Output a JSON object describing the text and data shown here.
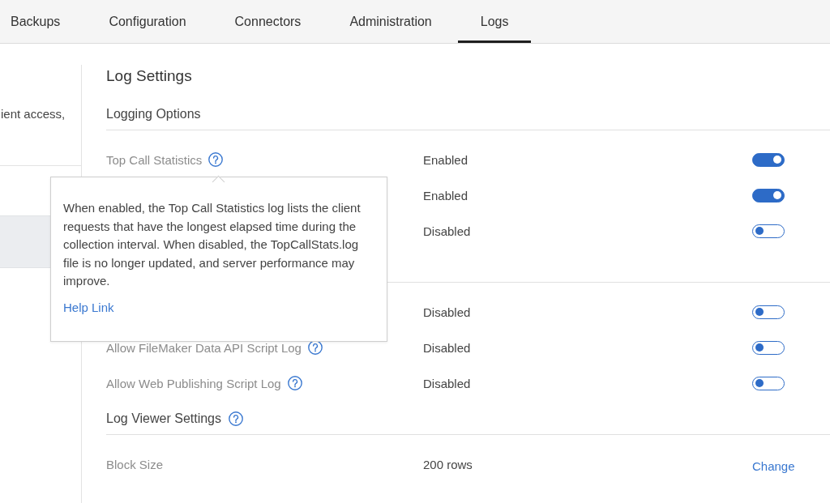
{
  "tabs": [
    {
      "label": "Backups",
      "selected": false
    },
    {
      "label": "Configuration",
      "selected": false
    },
    {
      "label": "Connectors",
      "selected": false
    },
    {
      "label": "Administration",
      "selected": false
    },
    {
      "label": "Logs",
      "selected": true
    }
  ],
  "sidebar": {
    "description": "ient access,",
    "items": [
      {
        "selected": true
      }
    ]
  },
  "title": "Log Settings",
  "sections": [
    {
      "title": "Logging Options",
      "rows": [
        {
          "kind": "toggle",
          "label": "Top Call Statistics",
          "help": true,
          "value": "Enabled",
          "on": true
        },
        {
          "kind": "toggle",
          "value": "Enabled",
          "on": true
        },
        {
          "kind": "toggle",
          "value": "Disabled",
          "on": false
        }
      ]
    },
    {
      "rows": [
        {
          "kind": "toggle",
          "value": "Disabled",
          "on": false
        },
        {
          "kind": "toggle",
          "label": "Allow FileMaker Data API Script Log",
          "help": true,
          "value": "Disabled",
          "on": false
        },
        {
          "kind": "toggle",
          "label": "Allow Web Publishing Script Log",
          "help": true,
          "value": "Disabled",
          "on": false
        }
      ]
    },
    {
      "title": "Log Viewer Settings",
      "help": true,
      "rows": [
        {
          "kind": "link",
          "label": "Block Size",
          "value": "200 rows",
          "action": "Change"
        }
      ]
    }
  ],
  "tooltip": {
    "text": "When enabled, the Top Call Statistics log lists the client requests that have the longest elapsed time during the collection interval. When disabled, the TopCallStats.log file is no longer updated, and server performance may improve.",
    "link": "Help Link"
  }
}
